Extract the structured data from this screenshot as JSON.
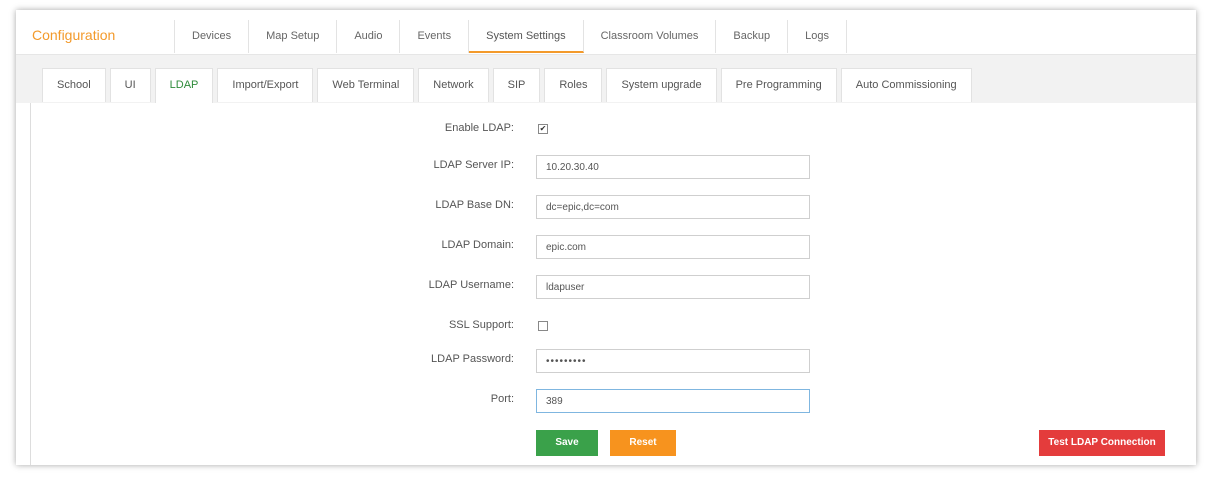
{
  "header": {
    "title": "Configuration"
  },
  "top_tabs": [
    {
      "label": "Devices"
    },
    {
      "label": "Map Setup"
    },
    {
      "label": "Audio"
    },
    {
      "label": "Events"
    },
    {
      "label": "System Settings",
      "active": true
    },
    {
      "label": "Classroom Volumes"
    },
    {
      "label": "Backup"
    },
    {
      "label": "Logs"
    }
  ],
  "sub_tabs": [
    {
      "label": "School"
    },
    {
      "label": "UI"
    },
    {
      "label": "LDAP",
      "active": true
    },
    {
      "label": "Import/Export"
    },
    {
      "label": "Web Terminal"
    },
    {
      "label": "Network"
    },
    {
      "label": "SIP"
    },
    {
      "label": "Roles"
    },
    {
      "label": "System upgrade"
    },
    {
      "label": "Pre Programming"
    },
    {
      "label": "Auto Commissioning"
    }
  ],
  "form": {
    "enable_ldap": {
      "label": "Enable LDAP:",
      "checked": true,
      "mark": "✔"
    },
    "server_ip": {
      "label": "LDAP Server IP:",
      "value": "10.20.30.40"
    },
    "base_dn": {
      "label": "LDAP Base DN:",
      "value": "dc=epic,dc=com"
    },
    "domain": {
      "label": "LDAP Domain:",
      "value": "epic.com"
    },
    "username": {
      "label": "LDAP Username:",
      "value": "ldapuser"
    },
    "ssl_support": {
      "label": "SSL Support:",
      "checked": false
    },
    "password": {
      "label": "LDAP Password:",
      "value": "•••••••••"
    },
    "port": {
      "label": "Port:",
      "value": "389"
    }
  },
  "buttons": {
    "save": "Save",
    "reset": "Reset",
    "test": "Test LDAP Connection"
  },
  "colors": {
    "accent_orange": "#f39a2b",
    "active_green": "#2e8b3a",
    "save_green": "#3aa14a",
    "reset_orange": "#f7931e",
    "test_red": "#e43c3c"
  }
}
